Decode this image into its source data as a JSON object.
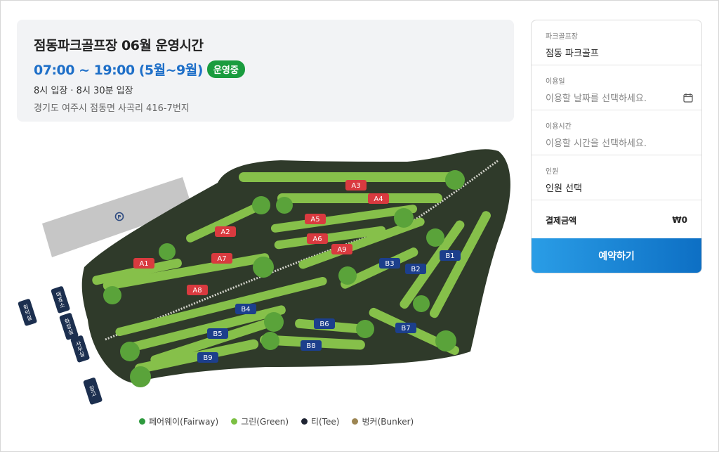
{
  "info": {
    "title": "점동파크골프장 06월 운영시간",
    "hours": "07:00 ~ 19:00 (5월~9월)",
    "status_badge": "운영중",
    "entry": "8시 입장 · 8시 30분 입장",
    "address": "경기도 여주시 점동면 사곡리 416-7번지"
  },
  "booking": {
    "course_label": "파크골프장",
    "course_value": "점동 파크골프",
    "date_label": "이용일",
    "date_placeholder": "이용할 날짜를 선택하세요.",
    "time_label": "이용시간",
    "time_placeholder": "이용할 시간을 선택하세요.",
    "people_label": "인원",
    "people_value": "인원 선택",
    "price_label": "결제금액",
    "price_value": "₩0",
    "reserve_label": "예약하기"
  },
  "map": {
    "a_holes": [
      "A1",
      "A2",
      "A3",
      "A4",
      "A5",
      "A6",
      "A7",
      "A8",
      "A9"
    ],
    "b_holes": [
      "B1",
      "B2",
      "B3",
      "B4",
      "B5",
      "B6",
      "B7",
      "B8",
      "B9"
    ],
    "buildings": [
      "회의실",
      "매표소",
      "화장실",
      "사무실",
      "창고"
    ],
    "colors": {
      "a_label": "#d93a3f",
      "b_label": "#1c3f8c",
      "ground": "#2f3a2a",
      "fairway": "#86c04a",
      "green": "#5aa33a",
      "bunker": "#c9a26b",
      "parking": "#c9c9c9"
    }
  },
  "legend": [
    {
      "label": "페어웨이(Fairway)",
      "color": "#2e9a3e"
    },
    {
      "label": "그린(Green)",
      "color": "#7cc043"
    },
    {
      "label": "티(Tee)",
      "color": "#1f2433"
    },
    {
      "label": "벙커(Bunker)",
      "color": "#9c8552"
    }
  ]
}
